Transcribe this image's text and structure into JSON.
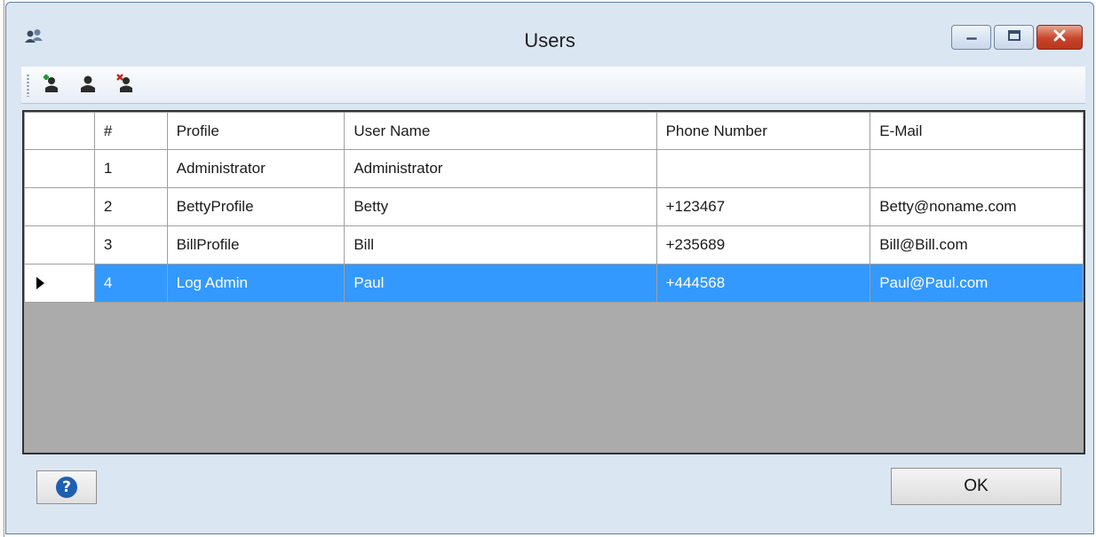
{
  "window": {
    "title": "Users",
    "app_icon": "users-group-icon",
    "controls": [
      "minimize-icon",
      "maximize-icon",
      "close-icon"
    ]
  },
  "toolbar": {
    "buttons": [
      {
        "name": "add-user-button",
        "icon": "user-add-icon"
      },
      {
        "name": "edit-user-button",
        "icon": "user-icon"
      },
      {
        "name": "delete-user-button",
        "icon": "user-delete-icon"
      }
    ]
  },
  "grid": {
    "columns": [
      "#",
      "Profile",
      "User Name",
      "Phone Number",
      "E-Mail"
    ],
    "rows": [
      {
        "num": "1",
        "profile": "Administrator",
        "user_name": "Administrator",
        "phone": "",
        "email": ""
      },
      {
        "num": "2",
        "profile": "BettyProfile",
        "user_name": "Betty",
        "phone": "+123467",
        "email": "Betty@noname.com"
      },
      {
        "num": "3",
        "profile": "BillProfile",
        "user_name": "Bill",
        "phone": "+235689",
        "email": "Bill@Bill.com"
      },
      {
        "num": "4",
        "profile": "Log Admin",
        "user_name": "Paul",
        "phone": "+444568",
        "email": "Paul@Paul.com"
      }
    ],
    "selected_row": "4"
  },
  "footer": {
    "help_icon": "help-icon",
    "help_glyph": "?",
    "ok_label": "OK"
  },
  "colors": {
    "selection": "#3399ff",
    "grid_background": "#ababab",
    "window_frame": "#dbe6f3"
  }
}
